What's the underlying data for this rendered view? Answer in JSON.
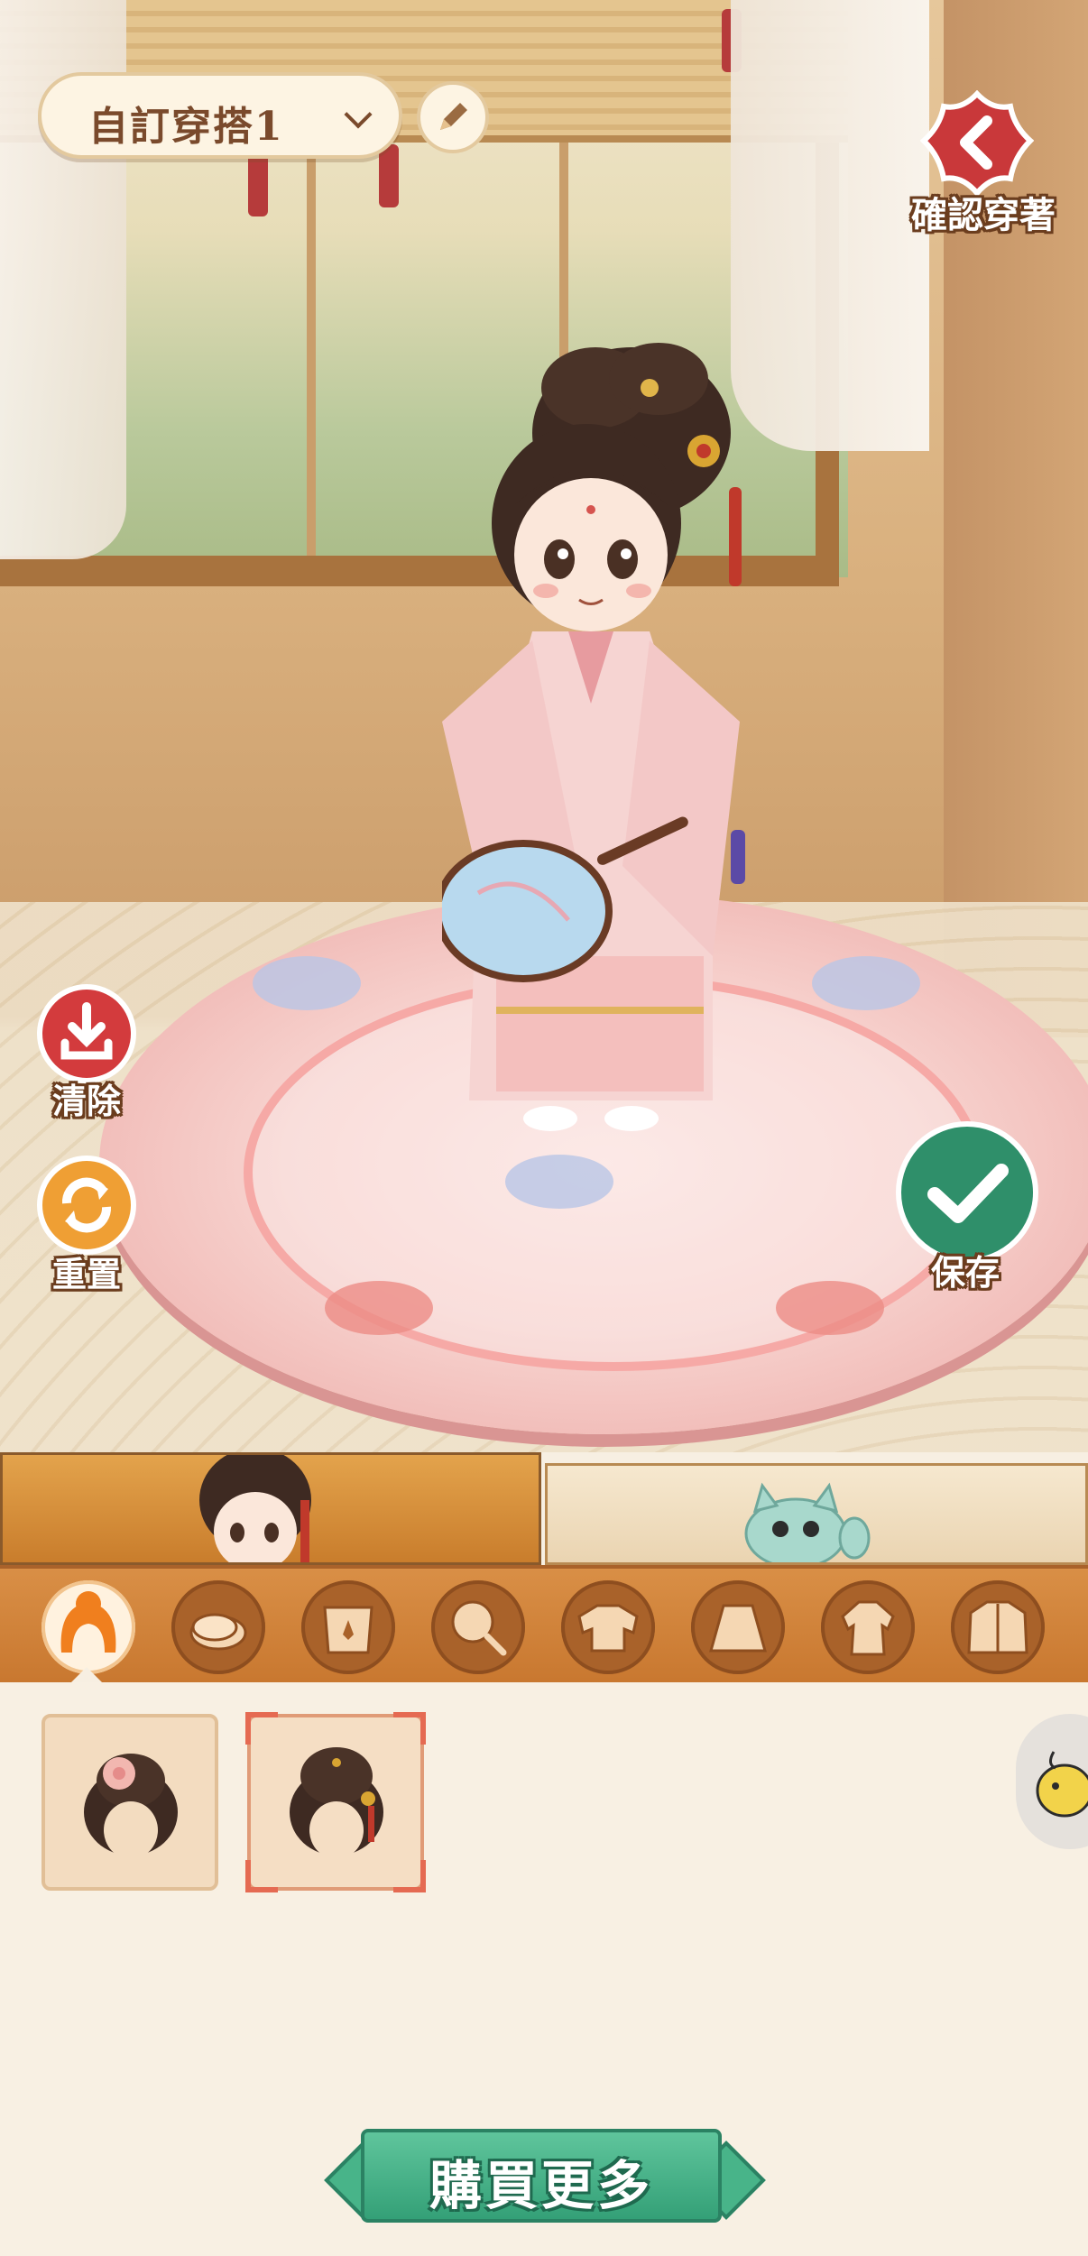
{
  "outfit": {
    "name": "自訂穿搭1"
  },
  "actions": {
    "confirm_label": "確認穿著",
    "clear_label": "清除",
    "reset_label": "重置",
    "save_label": "保存",
    "buy_more_label": "購買更多"
  },
  "tabs": [
    {
      "id": "character",
      "icon": "character-portrait",
      "active": true
    },
    {
      "id": "pet",
      "icon": "pet-cat-portrait",
      "active": false
    }
  ],
  "categories": [
    {
      "id": "hair",
      "icon": "hair-icon",
      "active": true
    },
    {
      "id": "face",
      "icon": "face-icon",
      "active": false
    },
    {
      "id": "accessory",
      "icon": "accessory-icon",
      "active": false
    },
    {
      "id": "handheld",
      "icon": "fan-icon",
      "active": false
    },
    {
      "id": "top",
      "icon": "top-icon",
      "active": false
    },
    {
      "id": "skirt",
      "icon": "skirt-icon",
      "active": false
    },
    {
      "id": "outer",
      "icon": "robe-icon",
      "active": false
    },
    {
      "id": "coat",
      "icon": "coat-icon",
      "active": false
    }
  ],
  "items": [
    {
      "icon": "hairstyle-flower-bun",
      "selected": false
    },
    {
      "icon": "hairstyle-gold-hairpin-bun",
      "selected": true
    }
  ],
  "colors": {
    "accent_red": "#c9383a",
    "accent_green": "#34a077",
    "accent_orange": "#e9932f",
    "panel_bg": "#f8f0e3"
  }
}
